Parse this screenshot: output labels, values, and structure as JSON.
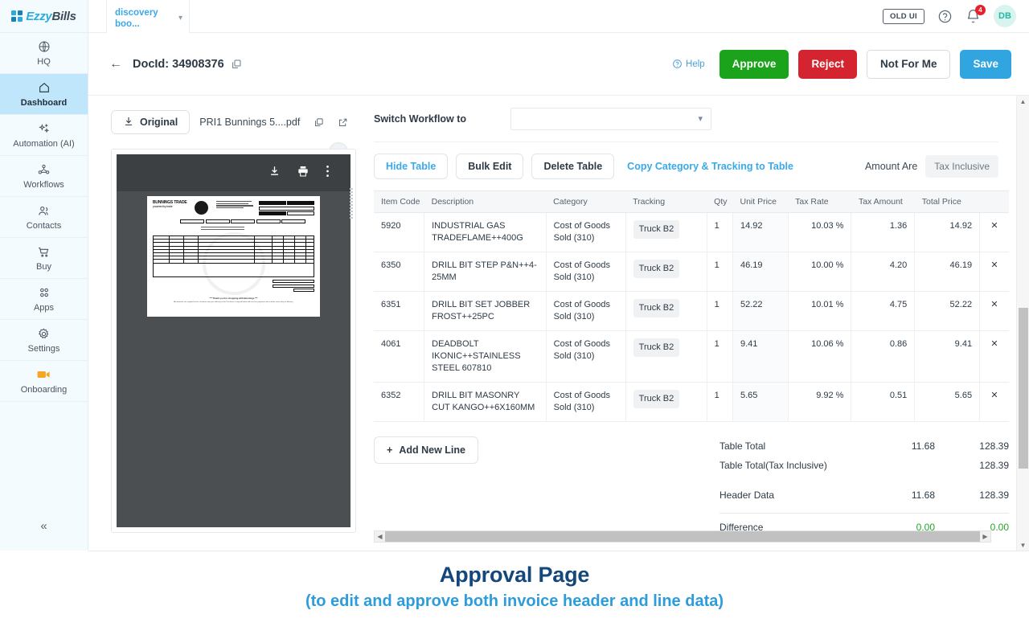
{
  "topbar": {
    "brand_first": "Ezzy",
    "brand_second": "Bills",
    "workflow_tab": "discovery boo...",
    "old_ui_label": "OLD UI",
    "help_icon": "question-circle-icon",
    "notification_icon": "bell-icon",
    "notification_count": "4",
    "avatar_initials": "DB"
  },
  "sidebar": {
    "items": [
      {
        "label": "HQ",
        "icon": "globe-icon",
        "active": false
      },
      {
        "label": "Dashboard",
        "icon": "home-icon",
        "active": true
      },
      {
        "label": "Automation (AI)",
        "icon": "sparkle-icon",
        "active": false
      },
      {
        "label": "Workflows",
        "icon": "workflow-nodes-icon",
        "active": false
      },
      {
        "label": "Contacts",
        "icon": "people-icon",
        "active": false
      },
      {
        "label": "Buy",
        "icon": "cart-icon",
        "active": false
      },
      {
        "label": "Apps",
        "icon": "grid-apps-icon",
        "active": false
      },
      {
        "label": "Settings",
        "icon": "gear-icon",
        "active": false
      },
      {
        "label": "Onboarding",
        "icon": "video-camera-icon",
        "active": false
      }
    ],
    "collapse_glyph": "«"
  },
  "doc_header": {
    "back_glyph": "←",
    "doc_id_label": "DocId: 34908376",
    "copy_icon": "copy-icon",
    "help_label": "Help",
    "approve_label": "Approve",
    "reject_label": "Reject",
    "not_for_me_label": "Not For Me",
    "save_label": "Save"
  },
  "pdf_pane": {
    "original_label": "Original",
    "download_icon": "download-icon",
    "file_name": "PRI1 Bunnings 5....pdf",
    "copy_icon": "copy-icon",
    "open_external_icon": "external-link-icon",
    "collapse_glyph": "←",
    "viewer": {
      "download_icon": "download-icon",
      "print_icon": "printer-icon",
      "more_icon": "more-vertical-icon",
      "invoice_brand_top": "BUNNINGS",
      "invoice_brand_bottom": "TRADE",
      "invoice_brand_sub": "powered by trade",
      "footer_note": "*** Thank you for shopping with Bunnings ***",
      "footer_fine": "All materials are supplied to the Customer from your delivery to the Purchaser is agreed below will not incur payment unless within seven days of delivery."
    }
  },
  "form": {
    "switch_workflow_label": "Switch Workflow to",
    "switch_workflow_value": "",
    "switch_workflow_placeholder": "",
    "chevron_icon": "chevron-down-icon",
    "toolbar": {
      "hide_table": "Hide Table",
      "bulk_edit": "Bulk Edit",
      "delete_table": "Delete Table",
      "copy_category": "Copy Category & Tracking to Table",
      "amount_are_label": "Amount Are",
      "tax_mode": "Tax Inclusive"
    },
    "table": {
      "columns": [
        "Item Code",
        "Description",
        "Category",
        "Tracking",
        "Qty",
        "Unit Price",
        "Tax Rate",
        "Tax Amount",
        "Total Price"
      ],
      "delete_glyph": "✕",
      "rows": [
        {
          "item_code": "5920",
          "description": "INDUSTRIAL GAS TRADEFLAME++400G",
          "category": "Cost of Goods Sold (310)",
          "tracking": "Truck B2",
          "qty": "1",
          "unit_price": "14.92",
          "tax_rate": "10.03 %",
          "tax_amount": "1.36",
          "total_price": "14.92"
        },
        {
          "item_code": "6350",
          "description": "DRILL BIT STEP P&N++4-25MM",
          "category": "Cost of Goods Sold (310)",
          "tracking": "Truck B2",
          "qty": "1",
          "unit_price": "46.19",
          "tax_rate": "10.00 %",
          "tax_amount": "4.20",
          "total_price": "46.19"
        },
        {
          "item_code": "6351",
          "description": "DRILL BIT SET JOBBER FROST++25PC",
          "category": "Cost of Goods Sold (310)",
          "tracking": "Truck B2",
          "qty": "1",
          "unit_price": "52.22",
          "tax_rate": "10.01 %",
          "tax_amount": "4.75",
          "total_price": "52.22"
        },
        {
          "item_code": "4061",
          "description": "DEADBOLT IKONIC++STAINLESS STEEL 607810",
          "category": "Cost of Goods Sold (310)",
          "tracking": "Truck B2",
          "qty": "1",
          "unit_price": "9.41",
          "tax_rate": "10.06 %",
          "tax_amount": "0.86",
          "total_price": "9.41"
        },
        {
          "item_code": "6352",
          "description": "DRILL BIT MASONRY CUT KANGO++6X160MM",
          "category": "Cost of Goods Sold (310)",
          "tracking": "Truck B2",
          "qty": "1",
          "unit_price": "5.65",
          "tax_rate": "9.92 %",
          "tax_amount": "0.51",
          "total_price": "5.65"
        }
      ]
    },
    "add_new_line_label": "Add New Line",
    "add_glyph": "+",
    "totals": [
      {
        "label": "Table Total",
        "tax": "11.68",
        "amount": "128.39",
        "green": false
      },
      {
        "label": "Table Total(Tax Inclusive)",
        "tax": "",
        "amount": "128.39",
        "green": false
      },
      {
        "label": "Header Data",
        "tax": "11.68",
        "amount": "128.39",
        "green": false
      },
      {
        "label": "Difference",
        "tax": "0.00",
        "amount": "0.00",
        "green": true
      }
    ]
  },
  "caption": {
    "title": "Approval Page",
    "subtitle": "(to edit and approve both invoice header and line data)"
  },
  "colors": {
    "brand_blue": "#29abe2",
    "accent_blue": "#3aa9e8",
    "approve_green": "#1ba31b",
    "reject_red": "#d32430",
    "save_blue": "#30a5e0",
    "caption_navy": "#14477a",
    "caption_blue": "#2d9cdb",
    "active_nav": "#bfe6fa",
    "difference_green": "#27a32b"
  }
}
